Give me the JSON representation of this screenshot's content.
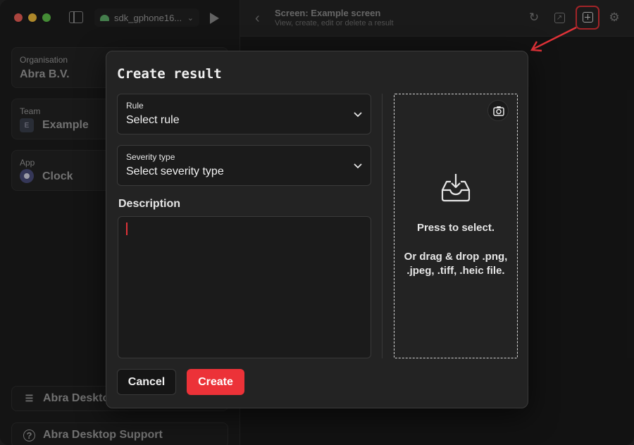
{
  "toolbar": {
    "device_name": "sdk_gphone16...",
    "screen_title": "Screen: Example screen",
    "screen_subtitle": "View, create, edit or delete a result"
  },
  "sidebar": {
    "organisation": {
      "label": "Organisation",
      "value": "Abra B.V."
    },
    "team": {
      "label": "Team",
      "value": "Example",
      "icon_letter": "E"
    },
    "app": {
      "label": "App",
      "value": "Clock"
    },
    "bottom_items": [
      {
        "label": "Abra Desktop",
        "icon": "sliders-icon"
      },
      {
        "label": "Abra Desktop Support",
        "icon": "help-icon"
      }
    ]
  },
  "modal": {
    "title": "Create result",
    "rule": {
      "label": "Rule",
      "value": "Select rule"
    },
    "severity": {
      "label": "Severity type",
      "value": "Select severity type"
    },
    "description_label": "Description",
    "description_value": "",
    "dropzone": {
      "line1": "Press to select.",
      "line2": "Or drag & drop .png, .jpeg, .tiff, .heic file."
    },
    "cancel_label": "Cancel",
    "create_label": "Create"
  },
  "colors": {
    "accent": "#ec3238",
    "highlight_border": "#e03238",
    "background": "#1a1a1a"
  }
}
